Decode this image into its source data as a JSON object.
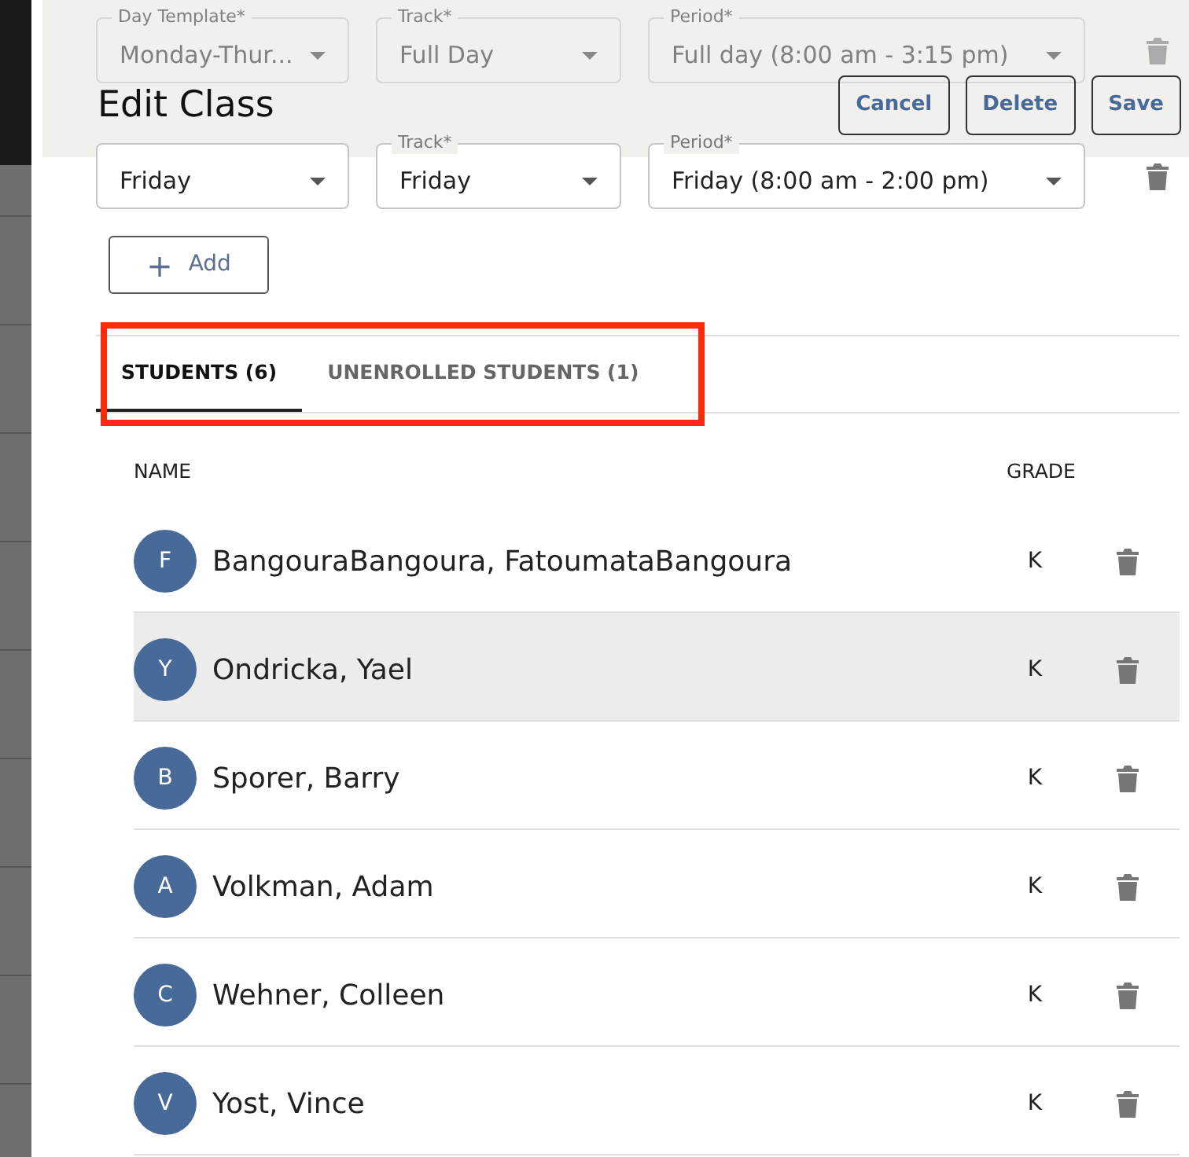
{
  "header": {
    "title": "Edit Class",
    "buttons": [
      "Cancel",
      "Delete",
      "Save"
    ]
  },
  "schedule_rows": [
    {
      "disabled": true,
      "fields": [
        {
          "label": "Day Template*",
          "value": "Monday-Thur..."
        },
        {
          "label": "Track*",
          "value": "Full Day"
        },
        {
          "label": "Period*",
          "value": "Full day (8:00 am - 3:15 pm)"
        }
      ]
    },
    {
      "disabled": false,
      "fields": [
        {
          "value": "Friday"
        },
        {
          "label": "Track*",
          "value": "Friday"
        },
        {
          "label": "Period*",
          "value": "Friday (8:00 am - 2:00 pm)"
        }
      ]
    }
  ],
  "add_button": {
    "icon": "+",
    "label": "Add"
  },
  "tabs": [
    {
      "label": "STUDENTS (6)",
      "selected": true
    },
    {
      "label": "UNENROLLED STUDENTS (1)",
      "selected": false
    }
  ],
  "table": {
    "columns": [
      "NAME",
      "GRADE"
    ],
    "rows": [
      {
        "initial": "F",
        "name": "BangouraBangoura, FatoumataBangoura",
        "grade": "K",
        "selected": false
      },
      {
        "initial": "Y",
        "name": "Ondricka, Yael",
        "grade": "K",
        "selected": true
      },
      {
        "initial": "B",
        "name": "Sporer, Barry",
        "grade": "K",
        "selected": false
      },
      {
        "initial": "A",
        "name": "Volkman, Adam",
        "grade": "K",
        "selected": false
      },
      {
        "initial": "C",
        "name": "Wehner, Colleen",
        "grade": "K",
        "selected": false
      },
      {
        "initial": "V",
        "name": "Yost, Vince",
        "grade": "K",
        "selected": false
      }
    ]
  }
}
